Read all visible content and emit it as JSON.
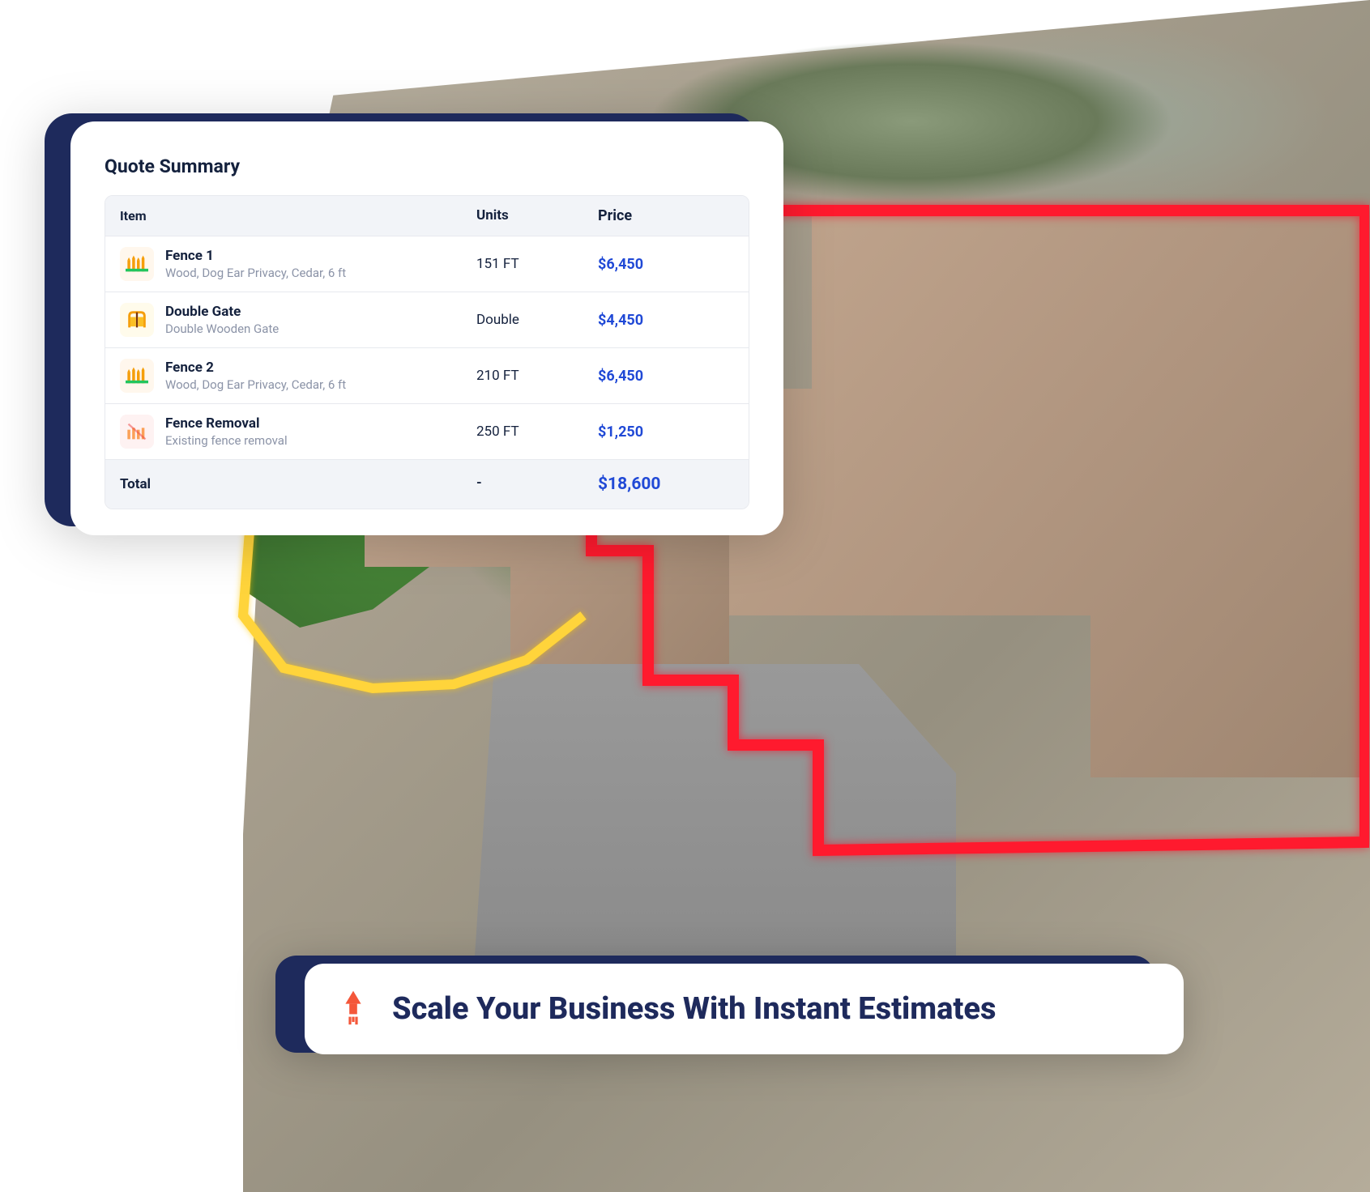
{
  "quote": {
    "title": "Quote Summary",
    "headers": {
      "item": "Item",
      "units": "Units",
      "price": "Price"
    },
    "rows": [
      {
        "icon": "fence-icon",
        "name": "Fence 1",
        "desc": "Wood, Dog Ear Privacy, Cedar, 6 ft",
        "units": "151 FT",
        "price": "$6,450"
      },
      {
        "icon": "gate-icon",
        "name": "Double Gate",
        "desc": "Double Wooden Gate",
        "units": "Double",
        "price": "$4,450"
      },
      {
        "icon": "fence-icon",
        "name": "Fence 2",
        "desc": "Wood, Dog Ear Privacy, Cedar, 6 ft",
        "units": "210 FT",
        "price": "$6,450"
      },
      {
        "icon": "removal-icon",
        "name": "Fence Removal",
        "desc": "Existing fence removal",
        "units": "250 FT",
        "price": "$1,250"
      }
    ],
    "total": {
      "label": "Total",
      "units": "-",
      "price": "$18,600"
    }
  },
  "cta": {
    "text": "Scale Your Business With Instant Estimates"
  },
  "colors": {
    "navy": "#1e2a5c",
    "priceBlue": "#2049d6",
    "accentRed": "#ff1a2e",
    "accentYellow": "#ffd43b",
    "ctaIcon": "#f4573a"
  }
}
